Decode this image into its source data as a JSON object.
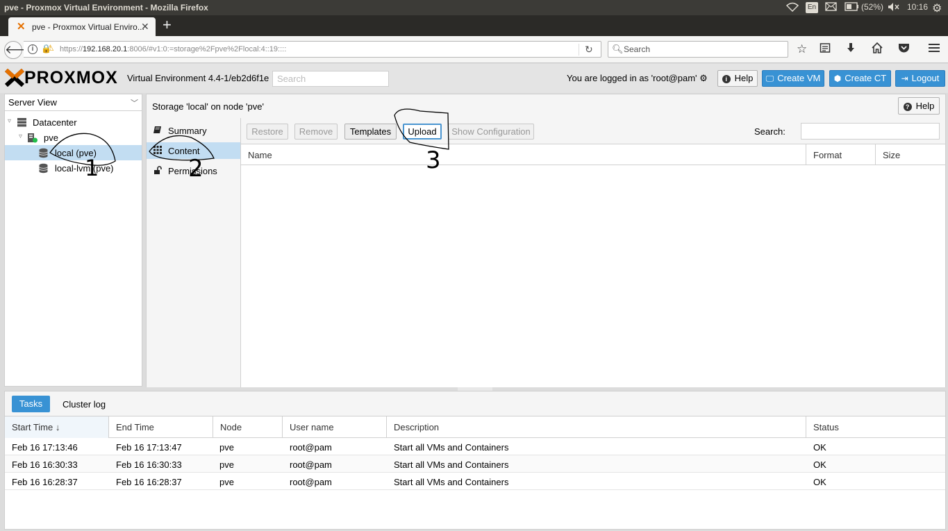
{
  "os": {
    "window_title": "pve - Proxmox Virtual Environment - Mozilla Firefox",
    "language": "En",
    "battery": "(52%)",
    "time": "10:16"
  },
  "browser": {
    "tab_title": "pve - Proxmox Virtual Enviro...",
    "url_prefix": "https://",
    "url_host": "192.168.20.1",
    "url_rest": ":8006/#v1:0:=storage%2Fpve%2Flocal:4::19::::",
    "search_placeholder": "Search"
  },
  "header": {
    "logo_text": "PROXMOX",
    "version": "Virtual Environment 4.4-1/eb2d6f1e",
    "search_placeholder": "Search",
    "logged_in": "You are logged in as 'root@pam'",
    "help": "Help",
    "create_vm": "Create VM",
    "create_ct": "Create CT",
    "logout": "Logout"
  },
  "tree": {
    "view": "Server View",
    "items": [
      {
        "label": "Datacenter"
      },
      {
        "label": "pve"
      },
      {
        "label": "local (pve)"
      },
      {
        "label": "local-lvm (pve)"
      }
    ]
  },
  "storage": {
    "title": "Storage 'local' on node 'pve'",
    "help": "Help",
    "nav": [
      {
        "label": "Summary"
      },
      {
        "label": "Content"
      },
      {
        "label": "Permissions"
      }
    ],
    "toolbar": {
      "restore": "Restore",
      "remove": "Remove",
      "templates": "Templates",
      "upload": "Upload",
      "show_config": "Show Configuration",
      "search_label": "Search:"
    },
    "columns": [
      "Name",
      "Format",
      "Size"
    ]
  },
  "tasks": {
    "tabs": [
      "Tasks",
      "Cluster log"
    ],
    "columns": [
      "Start Time ↓",
      "End Time",
      "Node",
      "User name",
      "Description",
      "Status"
    ],
    "rows": [
      [
        "Feb 16 17:13:46",
        "Feb 16 17:13:47",
        "pve",
        "root@pam",
        "Start all VMs and Containers",
        "OK"
      ],
      [
        "Feb 16 16:30:33",
        "Feb 16 16:30:33",
        "pve",
        "root@pam",
        "Start all VMs and Containers",
        "OK"
      ],
      [
        "Feb 16 16:28:37",
        "Feb 16 16:28:37",
        "pve",
        "root@pam",
        "Start all VMs and Containers",
        "OK"
      ]
    ]
  },
  "annotations": [
    "1",
    "2",
    "3"
  ],
  "colors": {
    "accent": "#3892d4",
    "brand": "#e57000",
    "selection": "#c2ddf2"
  }
}
